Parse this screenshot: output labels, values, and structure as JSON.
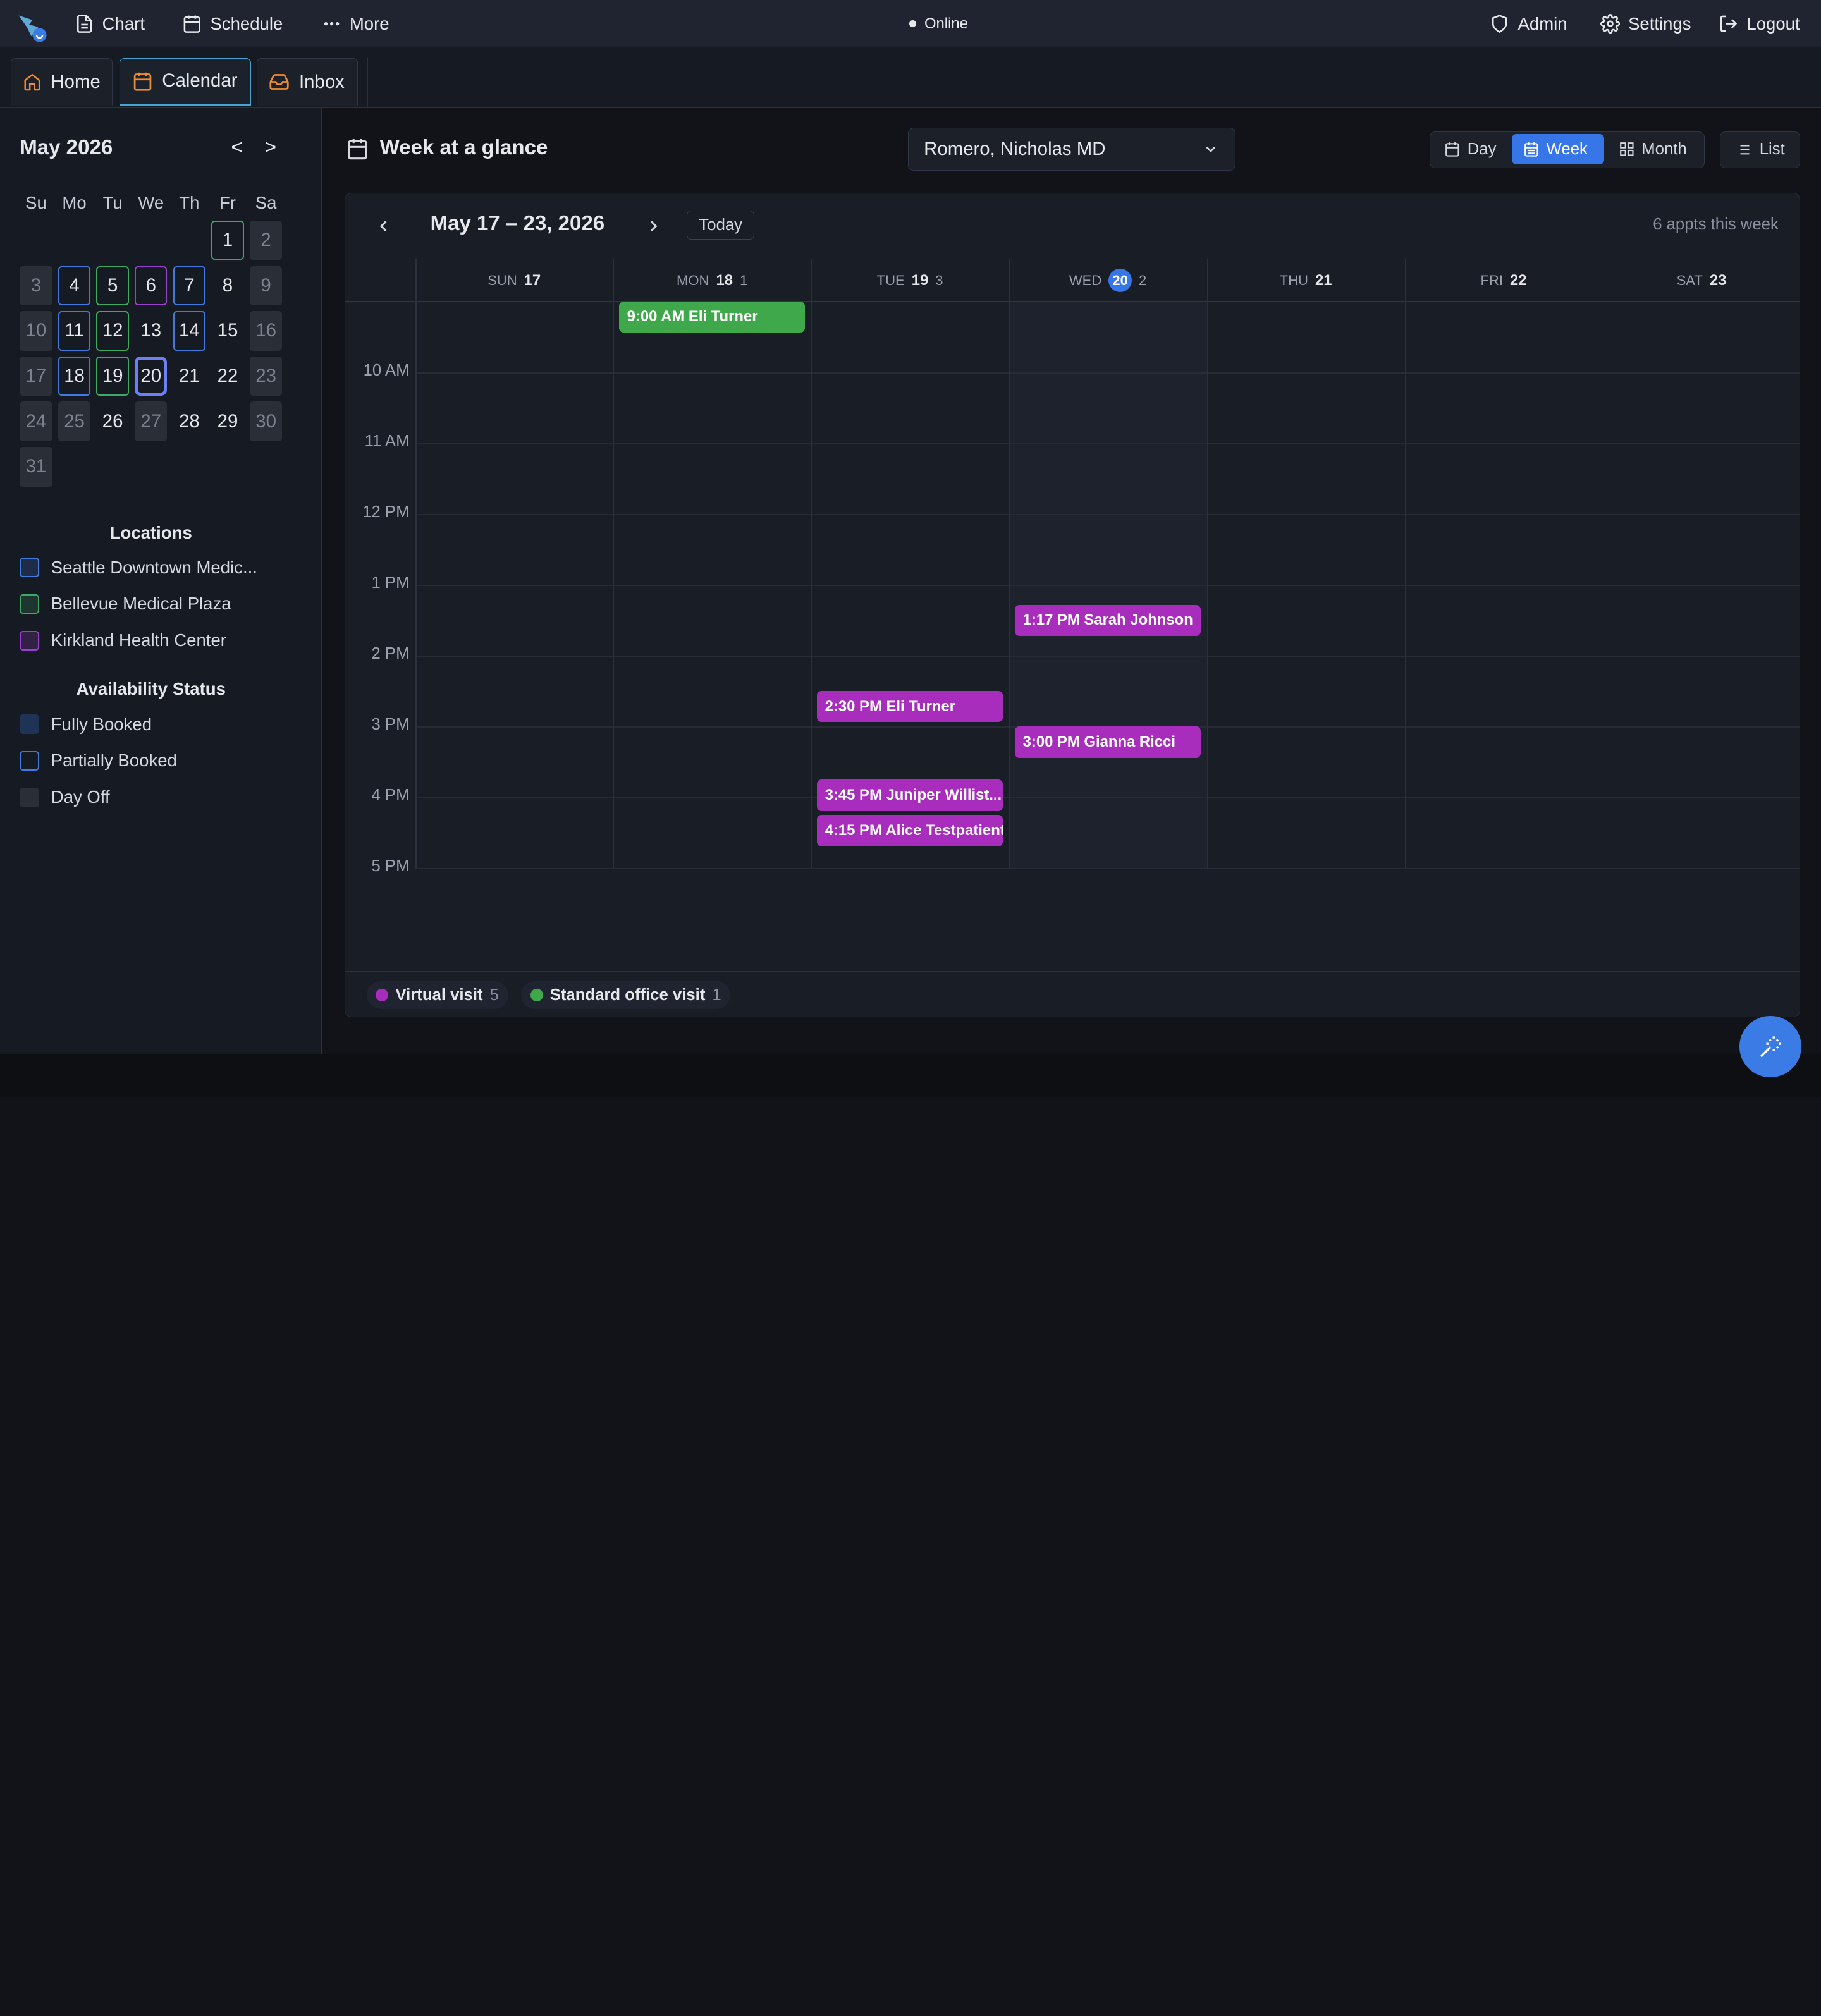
{
  "topbar": {
    "nav": [
      {
        "label": "Chart",
        "icon": "document-icon"
      },
      {
        "label": "Schedule",
        "icon": "calendar-icon"
      },
      {
        "label": "More",
        "icon": "more-icon"
      }
    ],
    "status": "Online",
    "right": [
      {
        "label": "Admin",
        "icon": "shield-icon"
      },
      {
        "label": "Settings",
        "icon": "gear-icon"
      },
      {
        "label": "Logout",
        "icon": "logout-icon"
      }
    ]
  },
  "tabs": [
    {
      "label": "Home",
      "icon": "home-icon",
      "active": false
    },
    {
      "label": "Calendar",
      "icon": "calendar-icon",
      "active": true
    },
    {
      "label": "Inbox",
      "icon": "inbox-icon",
      "active": false
    }
  ],
  "mini_calendar": {
    "title": "May 2026",
    "prev": "<",
    "next": ">",
    "weekdays": [
      "Su",
      "Mo",
      "Tu",
      "We",
      "Th",
      "Fr",
      "Sa"
    ],
    "days": [
      {
        "d": "1",
        "style": "b-green"
      },
      {
        "d": "2",
        "style": "muted"
      },
      {
        "d": "3",
        "style": "muted"
      },
      {
        "d": "4",
        "style": "b-blue"
      },
      {
        "d": "5",
        "style": "b-green"
      },
      {
        "d": "6",
        "style": "b-purple"
      },
      {
        "d": "7",
        "style": "b-blue"
      },
      {
        "d": "8",
        "style": ""
      },
      {
        "d": "9",
        "style": "muted"
      },
      {
        "d": "10",
        "style": "muted"
      },
      {
        "d": "11",
        "style": "b-blue"
      },
      {
        "d": "12",
        "style": "b-green"
      },
      {
        "d": "13",
        "style": ""
      },
      {
        "d": "14",
        "style": "b-blue"
      },
      {
        "d": "15",
        "style": ""
      },
      {
        "d": "16",
        "style": "muted"
      },
      {
        "d": "17",
        "style": "muted"
      },
      {
        "d": "18",
        "style": "b-blue"
      },
      {
        "d": "19",
        "style": "b-green"
      },
      {
        "d": "20",
        "style": "today"
      },
      {
        "d": "21",
        "style": ""
      },
      {
        "d": "22",
        "style": ""
      },
      {
        "d": "23",
        "style": "muted"
      },
      {
        "d": "24",
        "style": "muted"
      },
      {
        "d": "25",
        "style": "muted"
      },
      {
        "d": "26",
        "style": ""
      },
      {
        "d": "27",
        "style": "muted"
      },
      {
        "d": "28",
        "style": ""
      },
      {
        "d": "29",
        "style": ""
      },
      {
        "d": "30",
        "style": "muted"
      },
      {
        "d": "31",
        "style": "muted"
      }
    ]
  },
  "locations": {
    "title": "Locations",
    "items": [
      {
        "label": "Seattle Downtown Medic...",
        "color": "#3f7ae0"
      },
      {
        "label": "Bellevue Medical Plaza",
        "color": "#3fa864"
      },
      {
        "label": "Kirkland Health Center",
        "color": "#9b3fd0"
      }
    ]
  },
  "availability": {
    "title": "Availability Status",
    "items": [
      {
        "label": "Fully Booked",
        "color": "#1e3356"
      },
      {
        "label": "Partially Booked",
        "color": "#3f7ae0"
      },
      {
        "label": "Day Off",
        "color": "#2a2e36"
      }
    ]
  },
  "main": {
    "title": "Week at a glance",
    "provider": "Romero, Nicholas MD",
    "views": [
      {
        "label": "Day",
        "active": false
      },
      {
        "label": "Week",
        "active": true
      },
      {
        "label": "Month",
        "active": false
      }
    ],
    "list_label": "List"
  },
  "calendar": {
    "range": "May 17 – 23, 2026",
    "today_label": "Today",
    "appt_count": "6 appts this week",
    "days": [
      {
        "dow": "SUN",
        "num": "17",
        "count": ""
      },
      {
        "dow": "MON",
        "num": "18",
        "count": "1"
      },
      {
        "dow": "TUE",
        "num": "19",
        "count": "3"
      },
      {
        "dow": "WED",
        "num": "20",
        "count": "2",
        "today": true
      },
      {
        "dow": "THU",
        "num": "21",
        "count": ""
      },
      {
        "dow": "FRI",
        "num": "22",
        "count": ""
      },
      {
        "dow": "SAT",
        "num": "23",
        "count": ""
      }
    ],
    "hours": [
      "10 AM",
      "11 AM",
      "12 PM",
      "1 PM",
      "2 PM",
      "3 PM",
      "4 PM",
      "5 PM"
    ],
    "events": [
      {
        "label": "9:00 AM Eli Turner",
        "day": 1,
        "start": 9.0,
        "type": "office"
      },
      {
        "label": "1:17 PM Sarah Johnson",
        "day": 3,
        "start": 13.283,
        "type": "virtual"
      },
      {
        "label": "2:30 PM Eli Turner",
        "day": 2,
        "start": 14.5,
        "type": "virtual"
      },
      {
        "label": "3:00 PM Gianna Ricci",
        "day": 3,
        "start": 15.0,
        "type": "virtual"
      },
      {
        "label": "3:45 PM Juniper Willist...",
        "day": 2,
        "start": 15.75,
        "type": "virtual"
      },
      {
        "label": "4:15 PM Alice Testpatient",
        "day": 2,
        "start": 16.25,
        "type": "virtual"
      }
    ],
    "legend": [
      {
        "label": "Virtual visit",
        "count": "5",
        "color": "#a92dbd"
      },
      {
        "label": "Standard office visit",
        "count": "1",
        "color": "#3fa84a"
      }
    ]
  }
}
